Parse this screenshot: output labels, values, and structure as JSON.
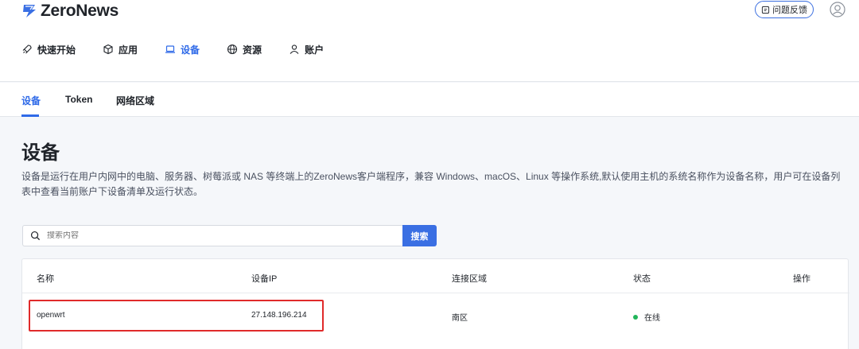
{
  "app": {
    "name": "ZeroNews"
  },
  "header": {
    "feedback_label": "问题反馈"
  },
  "nav": {
    "items": [
      {
        "label": "快速开始",
        "icon": "rocket-icon"
      },
      {
        "label": "应用",
        "icon": "cube-icon"
      },
      {
        "label": "设备",
        "icon": "laptop-icon",
        "active": true
      },
      {
        "label": "资源",
        "icon": "globe-icon"
      },
      {
        "label": "账户",
        "icon": "user-icon"
      }
    ]
  },
  "subtabs": [
    {
      "label": "设备",
      "active": true
    },
    {
      "label": "Token"
    },
    {
      "label": "网络区域"
    }
  ],
  "page": {
    "title": "设备",
    "description": "设备是运行在用户内网中的电脑、服务器、树莓派或 NAS 等终端上的ZeroNews客户端程序，兼容 Windows、macOS、Linux 等操作系统,默认使用主机的系统名称作为设备名称，用户可在设备列表中查看当前账户下设备清单及运行状态。"
  },
  "search": {
    "placeholder": "搜索内容",
    "button_label": "搜索"
  },
  "table": {
    "headers": [
      "名称",
      "设备IP",
      "连接区域",
      "状态",
      "操作"
    ],
    "rows": [
      {
        "name": "openwrt",
        "ip": "27.148.196.214",
        "region": "南区",
        "status": "在线"
      }
    ]
  },
  "colors": {
    "accent": "#2f6ae8",
    "online": "#22b55a",
    "highlight": "#e02a2a"
  }
}
